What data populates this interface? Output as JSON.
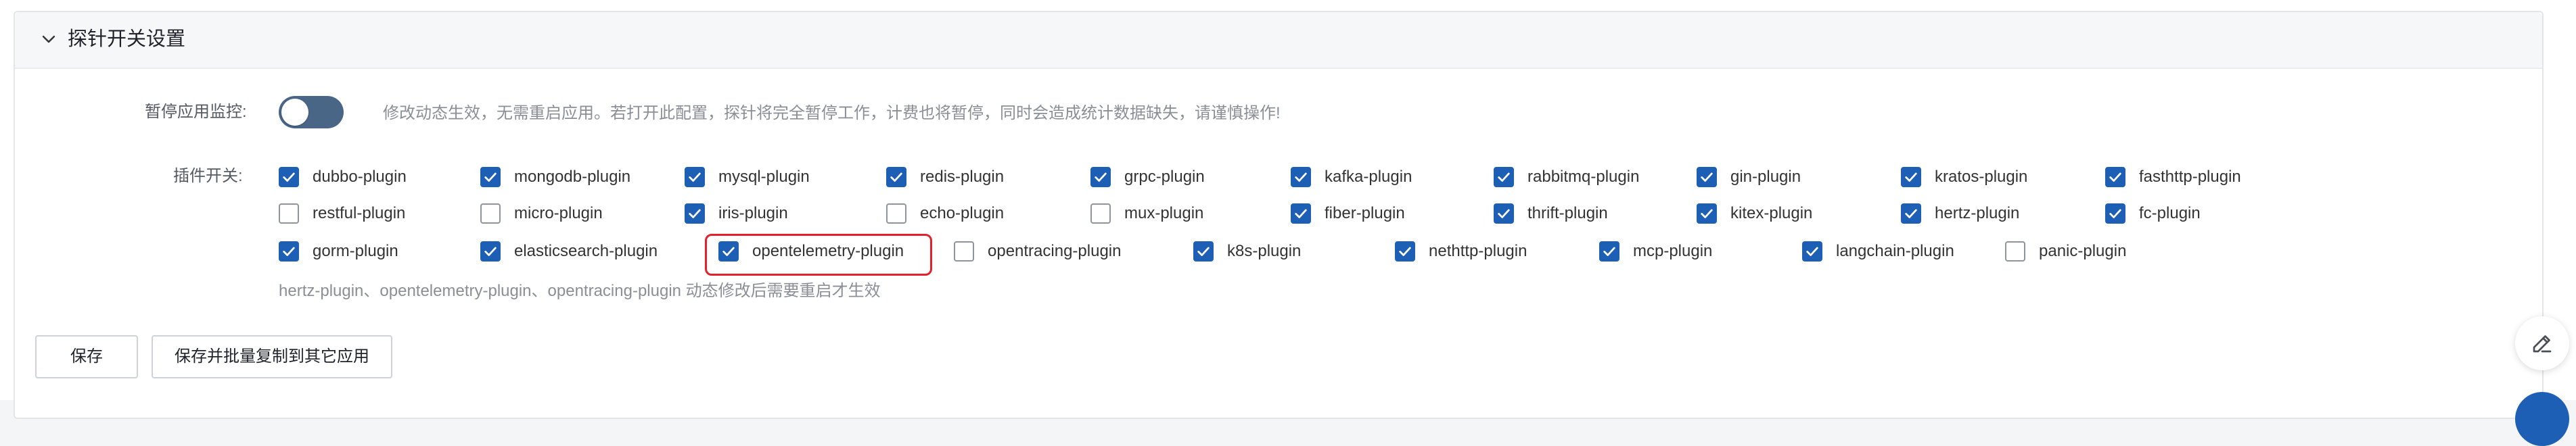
{
  "panel": {
    "title": "探针开关设置"
  },
  "pause_monitor": {
    "label": "暂停应用监控:",
    "enabled": false,
    "hint": "修改动态生效，无需重启应用。若打开此配置，探针将完全暂停工作，计费也将暂停，同时会造成统计数据缺失，请谨慎操作!"
  },
  "plugins": {
    "label": "插件开关:",
    "rows": [
      [
        {
          "name": "dubbo-plugin",
          "checked": true
        },
        {
          "name": "mongodb-plugin",
          "checked": true
        },
        {
          "name": "mysql-plugin",
          "checked": true
        },
        {
          "name": "redis-plugin",
          "checked": true
        },
        {
          "name": "grpc-plugin",
          "checked": true
        },
        {
          "name": "kafka-plugin",
          "checked": true
        },
        {
          "name": "rabbitmq-plugin",
          "checked": true
        },
        {
          "name": "gin-plugin",
          "checked": true
        },
        {
          "name": "kratos-plugin",
          "checked": true
        },
        {
          "name": "fasthttp-plugin",
          "checked": true
        }
      ],
      [
        {
          "name": "restful-plugin",
          "checked": false
        },
        {
          "name": "micro-plugin",
          "checked": false
        },
        {
          "name": "iris-plugin",
          "checked": true
        },
        {
          "name": "echo-plugin",
          "checked": false
        },
        {
          "name": "mux-plugin",
          "checked": false
        },
        {
          "name": "fiber-plugin",
          "checked": true
        },
        {
          "name": "thrift-plugin",
          "checked": true
        },
        {
          "name": "kitex-plugin",
          "checked": true
        },
        {
          "name": "hertz-plugin",
          "checked": true
        },
        {
          "name": "fc-plugin",
          "checked": true
        }
      ],
      [
        {
          "name": "gorm-plugin",
          "checked": true
        },
        {
          "name": "elasticsearch-plugin",
          "checked": true
        },
        {
          "name": "opentelemetry-plugin",
          "checked": true
        },
        {
          "name": "opentracing-plugin",
          "checked": false
        },
        {
          "name": "k8s-plugin",
          "checked": true
        },
        {
          "name": "nethttp-plugin",
          "checked": true
        },
        {
          "name": "mcp-plugin",
          "checked": true
        },
        {
          "name": "langchain-plugin",
          "checked": true
        },
        {
          "name": "panic-plugin",
          "checked": false
        }
      ]
    ],
    "note": "hertz-plugin、opentelemetry-plugin、opentracing-plugin 动态修改后需要重启才生效"
  },
  "actions": {
    "save_label": "保存",
    "save_copy_label": "保存并批量复制到其它应用"
  },
  "colors": {
    "accent": "#1d5fb4",
    "toggle": "#4a6687",
    "highlight": "#e2212d"
  },
  "icons": {
    "collapse": "chevron-down-icon",
    "fab": "pencil-edit-icon"
  }
}
